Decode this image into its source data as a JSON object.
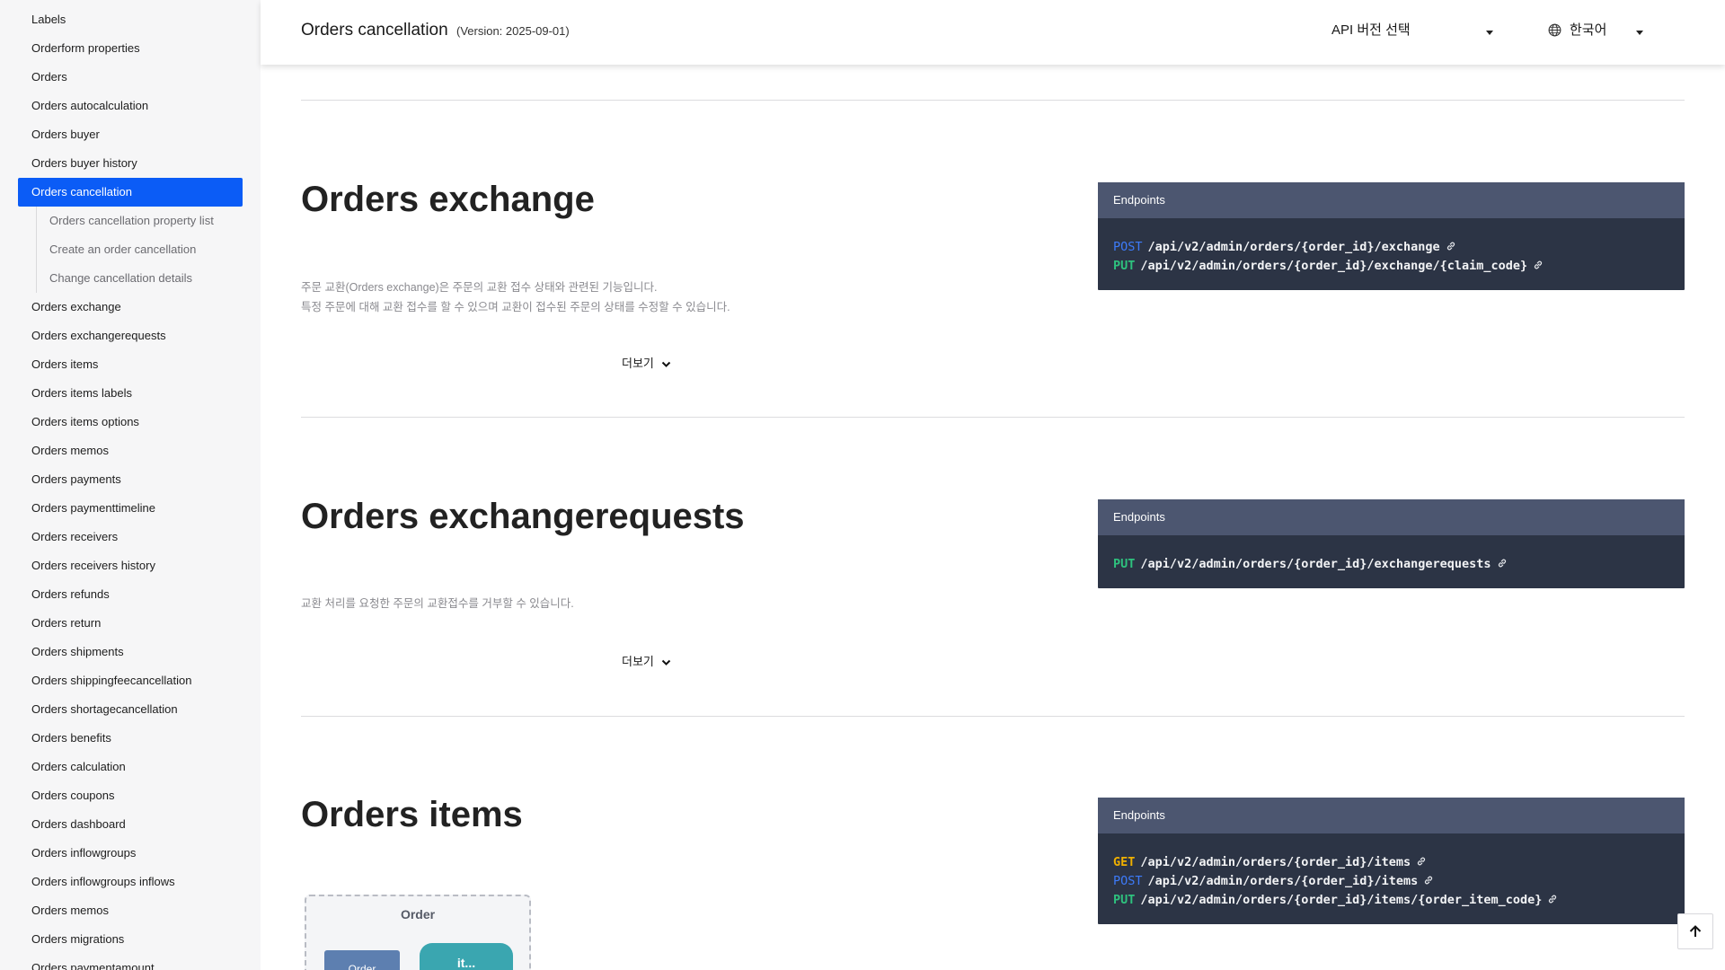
{
  "sidebar": {
    "items_before": [
      {
        "label": "Labels"
      },
      {
        "label": "Orderform properties"
      },
      {
        "label": "Orders"
      },
      {
        "label": "Orders autocalculation"
      },
      {
        "label": "Orders buyer"
      },
      {
        "label": "Orders buyer history"
      }
    ],
    "active_item": {
      "label": "Orders cancellation"
    },
    "sub_items": [
      {
        "label": "Orders cancellation property list"
      },
      {
        "label": "Create an order cancellation"
      },
      {
        "label": "Change cancellation details"
      }
    ],
    "items_after": [
      {
        "label": "Orders exchange"
      },
      {
        "label": "Orders exchangerequests"
      },
      {
        "label": "Orders items"
      },
      {
        "label": "Orders items labels"
      },
      {
        "label": "Orders items options"
      },
      {
        "label": "Orders memos"
      },
      {
        "label": "Orders payments"
      },
      {
        "label": "Orders paymenttimeline"
      },
      {
        "label": "Orders receivers"
      },
      {
        "label": "Orders receivers history"
      },
      {
        "label": "Orders refunds"
      },
      {
        "label": "Orders return"
      },
      {
        "label": "Orders shipments"
      },
      {
        "label": "Orders shippingfeecancellation"
      },
      {
        "label": "Orders shortagecancellation"
      },
      {
        "label": "Orders benefits"
      },
      {
        "label": "Orders calculation"
      },
      {
        "label": "Orders coupons"
      },
      {
        "label": "Orders dashboard"
      },
      {
        "label": "Orders inflowgroups"
      },
      {
        "label": "Orders inflowgroups inflows"
      },
      {
        "label": "Orders memos"
      },
      {
        "label": "Orders migrations"
      },
      {
        "label": "Orders paymentamount"
      }
    ]
  },
  "header": {
    "title": "Orders cancellation",
    "version": "(Version: 2025-09-01)",
    "version_select": "API 버전 선택",
    "language": "한국어"
  },
  "sections": {
    "exchange": {
      "title": "Orders exchange",
      "desc_line1": "주문 교환(Orders exchange)은 주문의 교환 접수 상태와 관련된 기능입니다.",
      "desc_line2": "특정 주문에 대해 교환 접수를 할 수 있으며 교환이 접수된 주문의 상태를 수정할 수 있습니다.",
      "more": "더보기",
      "endpoints_label": "Endpoints",
      "endpoints": [
        {
          "method": "POST",
          "path": "/api/v2/admin/orders/{order_id}/exchange"
        },
        {
          "method": "PUT",
          "path": "/api/v2/admin/orders/{order_id}/exchange/{claim_code}"
        }
      ]
    },
    "exchangerequests": {
      "title": "Orders exchangerequests",
      "desc_line1": "교환 처리를 요청한 주문의 교환접수를 거부할 수 있습니다.",
      "more": "더보기",
      "endpoints_label": "Endpoints",
      "endpoints": [
        {
          "method": "PUT",
          "path": "/api/v2/admin/orders/{order_id}/exchangerequests"
        }
      ]
    },
    "items": {
      "title": "Orders items",
      "endpoints_label": "Endpoints",
      "endpoints": [
        {
          "method": "GET",
          "path": "/api/v2/admin/orders/{order_id}/items"
        },
        {
          "method": "POST",
          "path": "/api/v2/admin/orders/{order_id}/items"
        },
        {
          "method": "PUT",
          "path": "/api/v2/admin/orders/{order_id}/items/{order_item_code}"
        }
      ],
      "diagram": {
        "title": "Order",
        "box_a": "Order",
        "box_b": "it..."
      }
    }
  },
  "colors": {
    "accent": "#0b5cf6",
    "code_bg": "#2c3445",
    "code_head": "#4c5670",
    "method_post": "#3d7bfa",
    "method_put": "#2ec27e",
    "method_get": "#f0b000"
  },
  "icons": [
    "globe-icon",
    "chevron-down-icon",
    "link-icon",
    "arrow-up-icon"
  ]
}
